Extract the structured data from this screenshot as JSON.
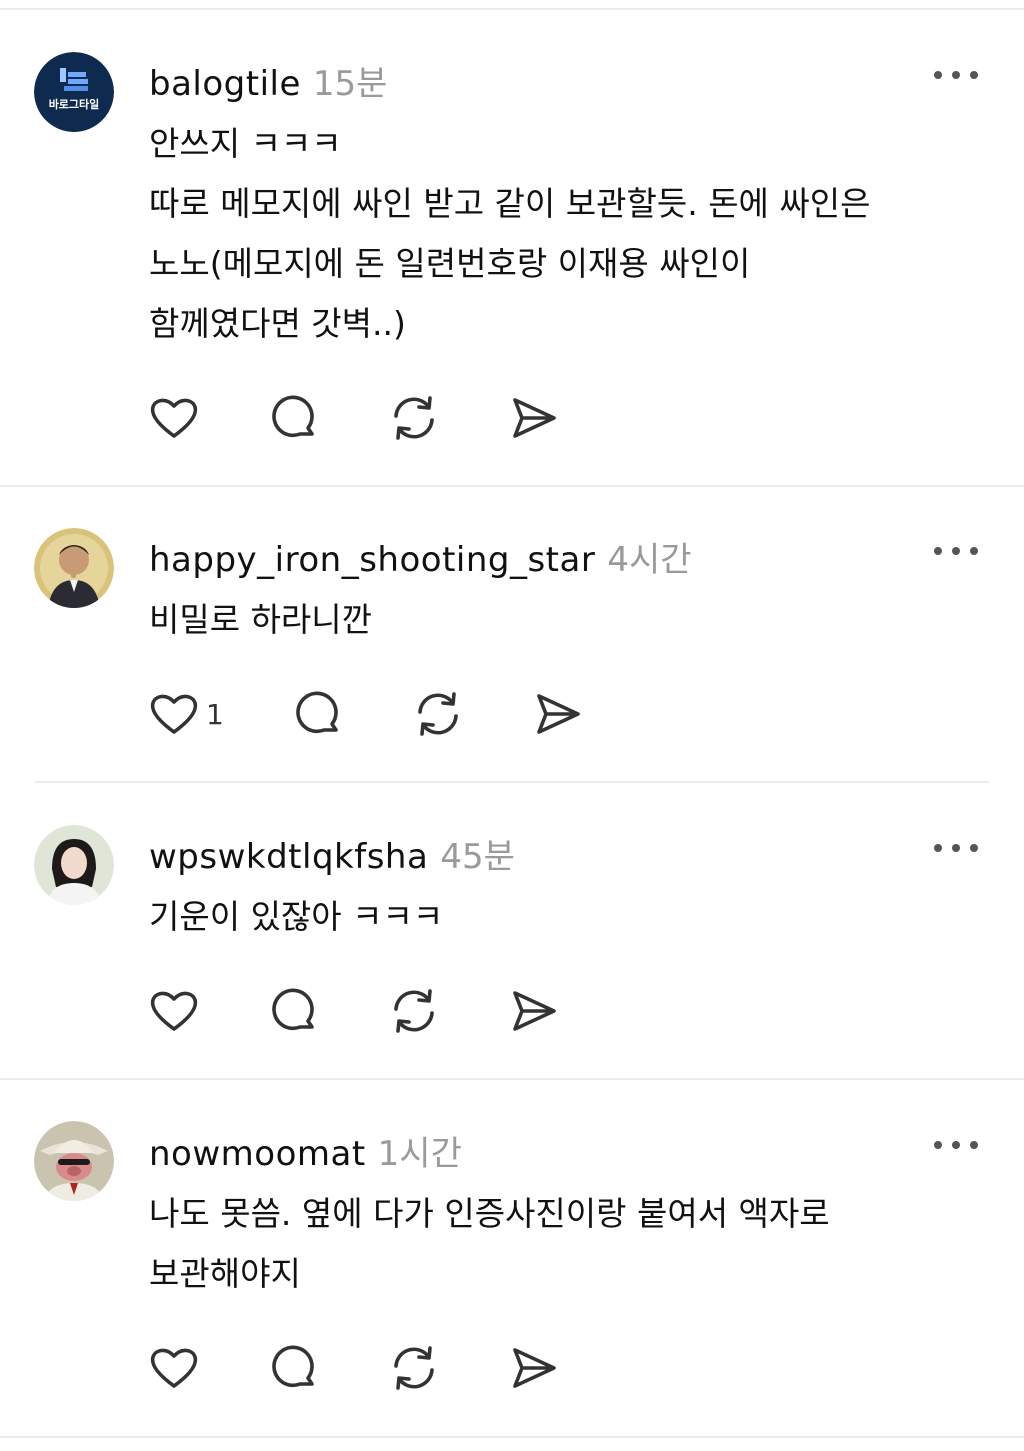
{
  "posts": [
    {
      "username": "balogtile",
      "time": "15분",
      "avatar_text": "바로그타일",
      "lines": [
        "안쓰지 ㅋㅋㅋ",
        "따로 메모지에 싸인 받고 같이 보관할듯. 돈에 싸인은",
        "노노(메모지에 돈 일련번호랑 이재용 싸인이",
        "함께였다면 갓벽..)"
      ],
      "like_count": ""
    },
    {
      "username": "happy_iron_shooting_star",
      "time": "4시간",
      "lines": [
        "비밀로 하라니깐"
      ],
      "like_count": "1"
    },
    {
      "username": "wpswkdtlqkfsha",
      "time": "45분",
      "lines": [
        "기운이 있잖아 ㅋㅋㅋ"
      ],
      "like_count": ""
    },
    {
      "username": "nowmoomat",
      "time": "1시간",
      "lines": [
        "나도 못씀. 옆에 다가 인증사진이랑 붙여서 액자로",
        "보관해야지"
      ],
      "like_count": ""
    }
  ],
  "icons": {
    "like": "heart-icon",
    "reply": "comment-icon",
    "repost": "repost-icon",
    "share": "send-icon",
    "more": "more-icon"
  }
}
